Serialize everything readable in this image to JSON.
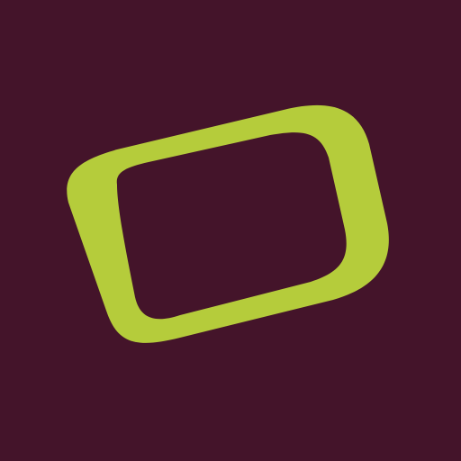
{
  "colors": {
    "background": "#44142A",
    "shape": "#B5CC3B"
  },
  "icon": "tilted-rounded-square-outline-icon"
}
